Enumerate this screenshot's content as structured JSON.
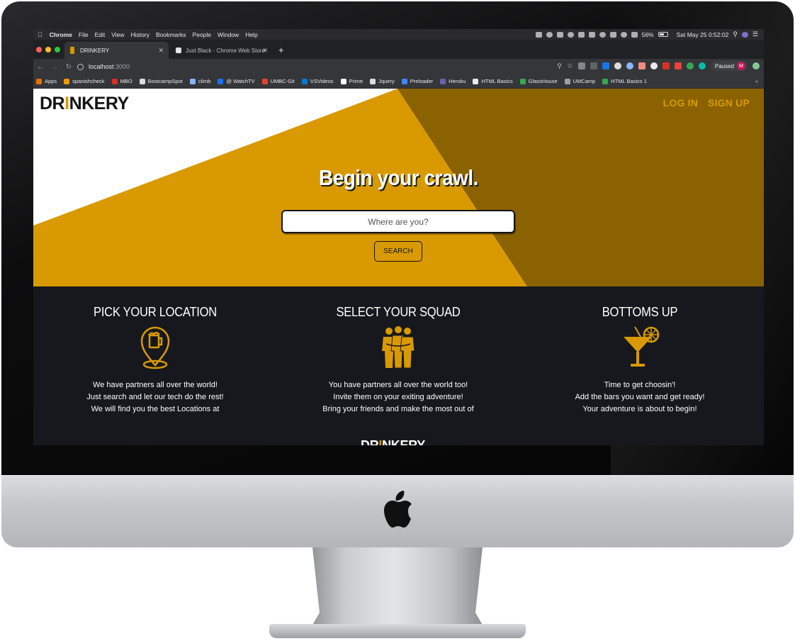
{
  "menubar": {
    "items": [
      "Chrome",
      "File",
      "Edit",
      "View",
      "History",
      "Bookmarks",
      "People",
      "Window",
      "Help"
    ],
    "battery": "56%",
    "clock": "Sat May 25  0:52:02"
  },
  "tabs": [
    {
      "title": "DRINKERY"
    },
    {
      "title": "Just Black - Chrome Web Store"
    }
  ],
  "toolbar": {
    "url_host": "localhost",
    "url_port": ":3000",
    "paused_label": "Paused",
    "avatar_initial": "M"
  },
  "bookmarks": [
    {
      "label": "Apps",
      "color": "#e37400"
    },
    {
      "label": "spanishcheck",
      "color": "#f29900"
    },
    {
      "label": "MBO",
      "color": "#d93025"
    },
    {
      "label": "BootcampSpot",
      "color": "#dadce0"
    },
    {
      "label": "climb",
      "color": "#8ab4f8"
    },
    {
      "label": "@ WatchTV",
      "color": "#1a73e8"
    },
    {
      "label": "UMBC-Git",
      "color": "#e24329"
    },
    {
      "label": "VSVideos",
      "color": "#007acc"
    },
    {
      "label": "Prime",
      "color": "#ffffff"
    },
    {
      "label": "Jquery",
      "color": "#dadce0"
    },
    {
      "label": "Preloader",
      "color": "#4285f4"
    },
    {
      "label": "Heroku",
      "color": "#6762a6"
    },
    {
      "label": "HTML Basics",
      "color": "#e8eaed"
    },
    {
      "label": "GlassHouse",
      "color": "#34a853"
    },
    {
      "label": "UMCamp",
      "color": "#9aa0a6"
    },
    {
      "label": "HTML Basics 1",
      "color": "#34a853"
    }
  ],
  "page": {
    "logo": {
      "pre": "DR",
      "i": "I",
      "post": "NKERY"
    },
    "login": "LOG IN",
    "signup": "SIGN UP",
    "hero_title": "Begin your crawl.",
    "search_placeholder": "Where are you?",
    "search_button": "SEARCH",
    "features": [
      {
        "title": "PICK YOUR LOCATION",
        "icon": "beer-location-pin-icon",
        "lines": [
          "We have partners all over the world!",
          "Just search and let our tech do the rest!",
          "We will find you the best Locations at"
        ]
      },
      {
        "title": "SELECT YOUR SQUAD",
        "icon": "group-of-friends-icon",
        "lines": [
          "You have partners all over the world too!",
          "Invite them on your exiting adventure!",
          "Bring your friends and make the most out of"
        ]
      },
      {
        "title": "BOTTOMS UP",
        "icon": "cocktail-glass-icon",
        "lines": [
          "Time to get choosin'!",
          "Add the bars you want and get ready!",
          "Your adventure is about to begin!"
        ]
      }
    ],
    "footer_logo": {
      "pre": "DR",
      "i": "I",
      "post": "NKERY"
    }
  },
  "colors": {
    "brand_gold": "#d89a00",
    "brand_brown": "#8a6200",
    "dark_section": "#17181d"
  }
}
